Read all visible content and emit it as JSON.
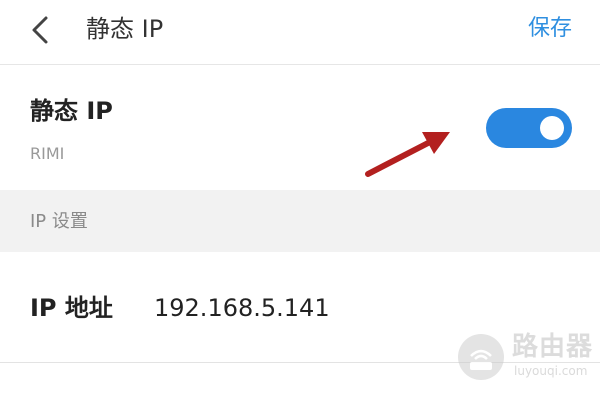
{
  "header": {
    "title": "静态 IP",
    "save_label": "保存",
    "back_icon": "chevron-left-icon"
  },
  "static_ip": {
    "title": "静态 IP",
    "network_name": "RIMI",
    "toggle_on": true,
    "accent_color": "#2a87e0"
  },
  "ip_settings": {
    "section_title": "IP 设置",
    "ip_address_label": "IP 地址",
    "ip_address_value": "192.168.5.141"
  },
  "watermark": {
    "text": "路由器",
    "subtext": "luyouqi.com"
  },
  "colors": {
    "arrow": "#b3201f",
    "section_bg": "#f2f2f2"
  }
}
